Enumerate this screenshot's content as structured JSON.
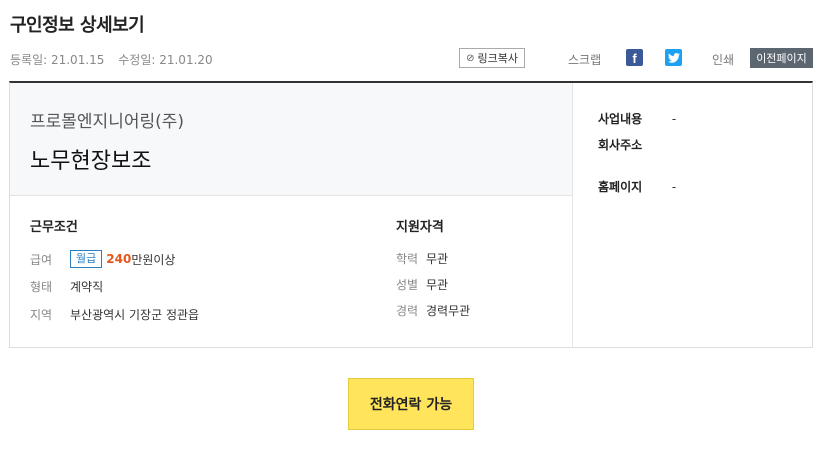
{
  "page": {
    "title": "구인정보 상세보기"
  },
  "meta": {
    "registered": "등록일: 21.01.15",
    "modified": "수정일: 21.01.20"
  },
  "actions": {
    "link_copy_label": "링크복사",
    "link_icon": "link-icon",
    "scrap_label": "스크랩",
    "facebook_icon": "facebook-icon",
    "facebook_glyph": "f",
    "twitter_icon": "twitter-icon",
    "print_label": "인쇄",
    "prev_page_label": "이전페이지",
    "colors": {
      "facebook": "#3b5998",
      "twitter": "#1da1f2",
      "prev_button": "#5b6670"
    }
  },
  "job": {
    "company": "프로몰엔지니어링(주)",
    "title": "노무현장보조"
  },
  "company_info": [
    {
      "key": "사업내용",
      "value": "-"
    },
    {
      "key": "회사주소",
      "value": ""
    },
    {
      "key": "홈페이지",
      "value": "-"
    }
  ],
  "conditions": {
    "title": "근무조건",
    "salary": {
      "key": "급여",
      "badge": "월급",
      "amount": "240",
      "unit": "만원이상"
    },
    "type": {
      "key": "형태",
      "value": "계약직"
    },
    "region": {
      "key": "지역",
      "value": "부산광역시 기장군 정관읍"
    }
  },
  "qualifications": {
    "title": "지원자격",
    "education": {
      "key": "학력",
      "value": "무관"
    },
    "gender": {
      "key": "성별",
      "value": "무관"
    },
    "experience": {
      "key": "경력",
      "value": "경력무관"
    }
  },
  "call_button": {
    "label": "전화연락 가능",
    "color": "#ffe45c"
  },
  "accent": {
    "salary": "#e8561c",
    "badge": "#2a7fc1"
  }
}
